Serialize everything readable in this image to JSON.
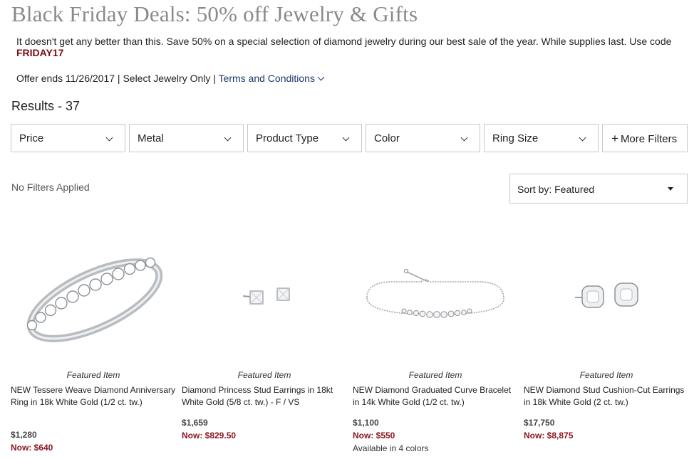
{
  "header": {
    "title": "Black Friday Deals: 50% off Jewelry & Gifts",
    "promo_text": "It doesn't get any better than this. Save 50% on a special selection of diamond jewelry during our best sale of the year. While supplies last. Use code",
    "promo_code": "FRIDAY17",
    "offer_text": "Offer ends 11/26/2017 | Select Jewelry Only |",
    "terms_label": "Terms and Conditions"
  },
  "results_label": "Results - 37",
  "filters": [
    {
      "label": "Price"
    },
    {
      "label": "Metal"
    },
    {
      "label": "Product Type"
    },
    {
      "label": "Color"
    },
    {
      "label": "Ring Size"
    }
  ],
  "more_filters_label": "More Filters",
  "no_filters_label": "No Filters Applied",
  "sort_label": "Sort by: Featured",
  "products": [
    {
      "featured": "Featured Item",
      "name": "NEW Tessere Weave Diamond Anniversary Ring in 18k White Gold (1/2 ct. tw.)",
      "original_price": "$1,280",
      "sale_price": "Now: $640",
      "colors": ""
    },
    {
      "featured": "Featured Item",
      "name": "Diamond Princess Stud Earrings in 18kt White Gold (5/8 ct. tw.) - F / VS",
      "original_price": "$1,659",
      "sale_price": "Now: $829.50",
      "colors": ""
    },
    {
      "featured": "Featured Item",
      "name": "NEW Diamond Graduated Curve Bracelet in 14k White Gold (1/2 ct. tw.)",
      "original_price": "$1,100",
      "sale_price": "Now: $550",
      "colors": "Available in 4 colors"
    },
    {
      "featured": "Featured Item",
      "name": "NEW Diamond Stud Cushion-Cut Earrings in 18k White Gold (2 ct. tw.)",
      "original_price": "$17,750",
      "sale_price": "Now: $8,875",
      "colors": ""
    }
  ],
  "colors": {
    "promo_code": "#7a0c14",
    "sale_price": "#8b1520",
    "link": "#1c3a6b",
    "title": "#8a8a8a"
  }
}
